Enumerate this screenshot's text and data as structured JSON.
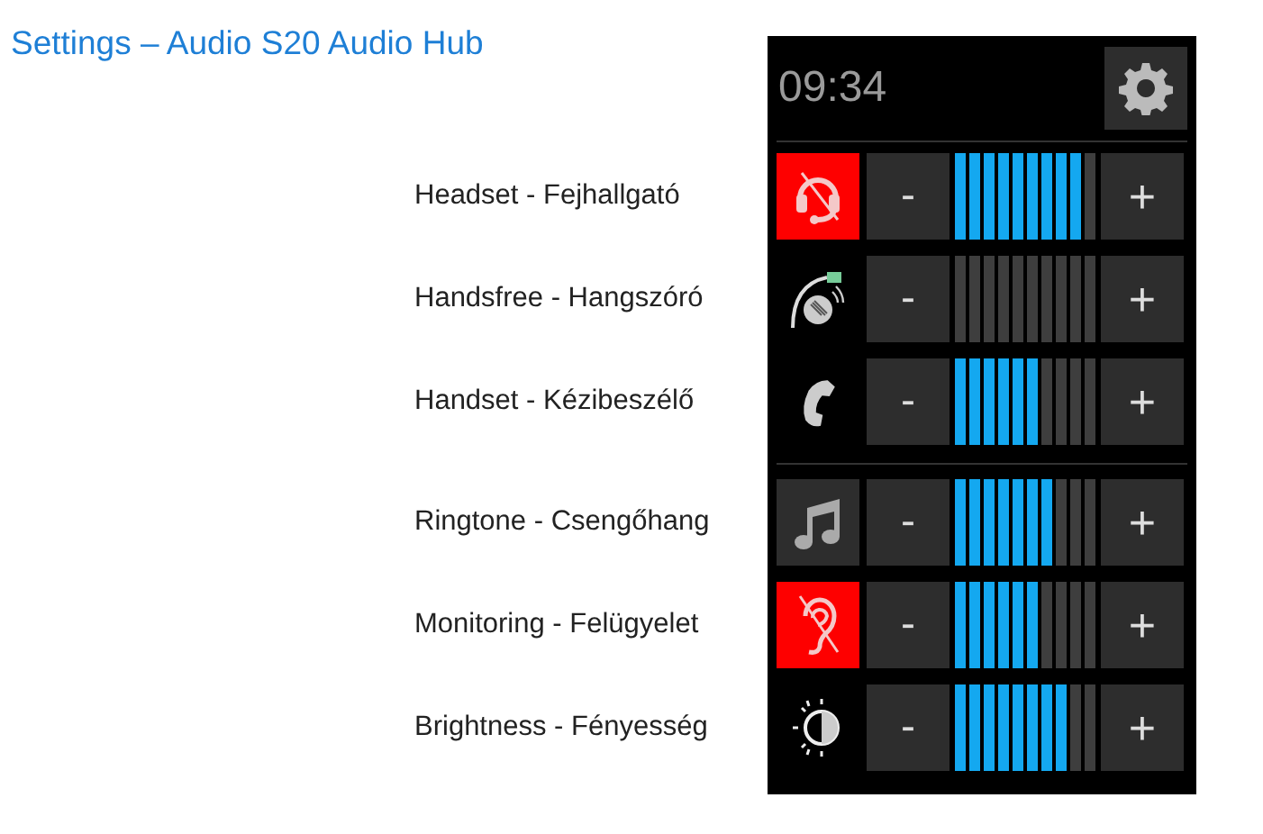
{
  "title": "Settings – Audio S20 Audio Hub",
  "clock": "09:34",
  "groups": [
    {
      "rows": [
        {
          "label": "Headset - Fejhallgató",
          "kind": "headset",
          "muted": true,
          "boxed": false,
          "minus": "-",
          "plus": "+",
          "segments": [
            {
              "on": true
            },
            {
              "on": true
            },
            {
              "on": true
            },
            {
              "on": true
            },
            {
              "on": true
            },
            {
              "on": true
            },
            {
              "on": true
            },
            {
              "on": true
            },
            {
              "on": true
            },
            {
              "on": false
            }
          ]
        },
        {
          "label": "Handsfree - Hangszóró",
          "kind": "handsfree",
          "muted": false,
          "boxed": false,
          "minus": "-",
          "plus": "+",
          "segments": [
            {
              "on": false
            },
            {
              "on": false
            },
            {
              "on": false
            },
            {
              "on": false
            },
            {
              "on": false
            },
            {
              "on": false
            },
            {
              "on": false
            },
            {
              "on": false
            },
            {
              "on": false
            },
            {
              "on": false
            }
          ]
        },
        {
          "label": "Handset - Kézibeszélő",
          "kind": "handset",
          "muted": false,
          "boxed": false,
          "minus": "-",
          "plus": "+",
          "segments": [
            {
              "on": true
            },
            {
              "on": true
            },
            {
              "on": true
            },
            {
              "on": true
            },
            {
              "on": true
            },
            {
              "on": true
            },
            {
              "on": false
            },
            {
              "on": false
            },
            {
              "on": false
            },
            {
              "on": false
            }
          ]
        }
      ]
    },
    {
      "rows": [
        {
          "label": "Ringtone - Csengőhang",
          "kind": "ringtone",
          "muted": false,
          "boxed": true,
          "minus": "-",
          "plus": "+",
          "segments": [
            {
              "on": true
            },
            {
              "on": true
            },
            {
              "on": true
            },
            {
              "on": true
            },
            {
              "on": true
            },
            {
              "on": true
            },
            {
              "on": true
            },
            {
              "on": false
            },
            {
              "on": false
            },
            {
              "on": false
            }
          ]
        },
        {
          "label": "Monitoring - Felügyelet",
          "kind": "monitoring",
          "muted": true,
          "boxed": false,
          "minus": "-",
          "plus": "+",
          "segments": [
            {
              "on": true
            },
            {
              "on": true
            },
            {
              "on": true
            },
            {
              "on": true
            },
            {
              "on": true
            },
            {
              "on": true
            },
            {
              "on": false
            },
            {
              "on": false
            },
            {
              "on": false
            },
            {
              "on": false
            }
          ]
        },
        {
          "label": "Brightness - Fényesség",
          "kind": "brightness",
          "muted": false,
          "boxed": false,
          "minus": "-",
          "plus": "+",
          "segments": [
            {
              "on": true
            },
            {
              "on": true
            },
            {
              "on": true
            },
            {
              "on": true
            },
            {
              "on": true
            },
            {
              "on": true
            },
            {
              "on": true
            },
            {
              "on": true
            },
            {
              "on": false
            },
            {
              "on": false
            }
          ]
        }
      ]
    }
  ]
}
